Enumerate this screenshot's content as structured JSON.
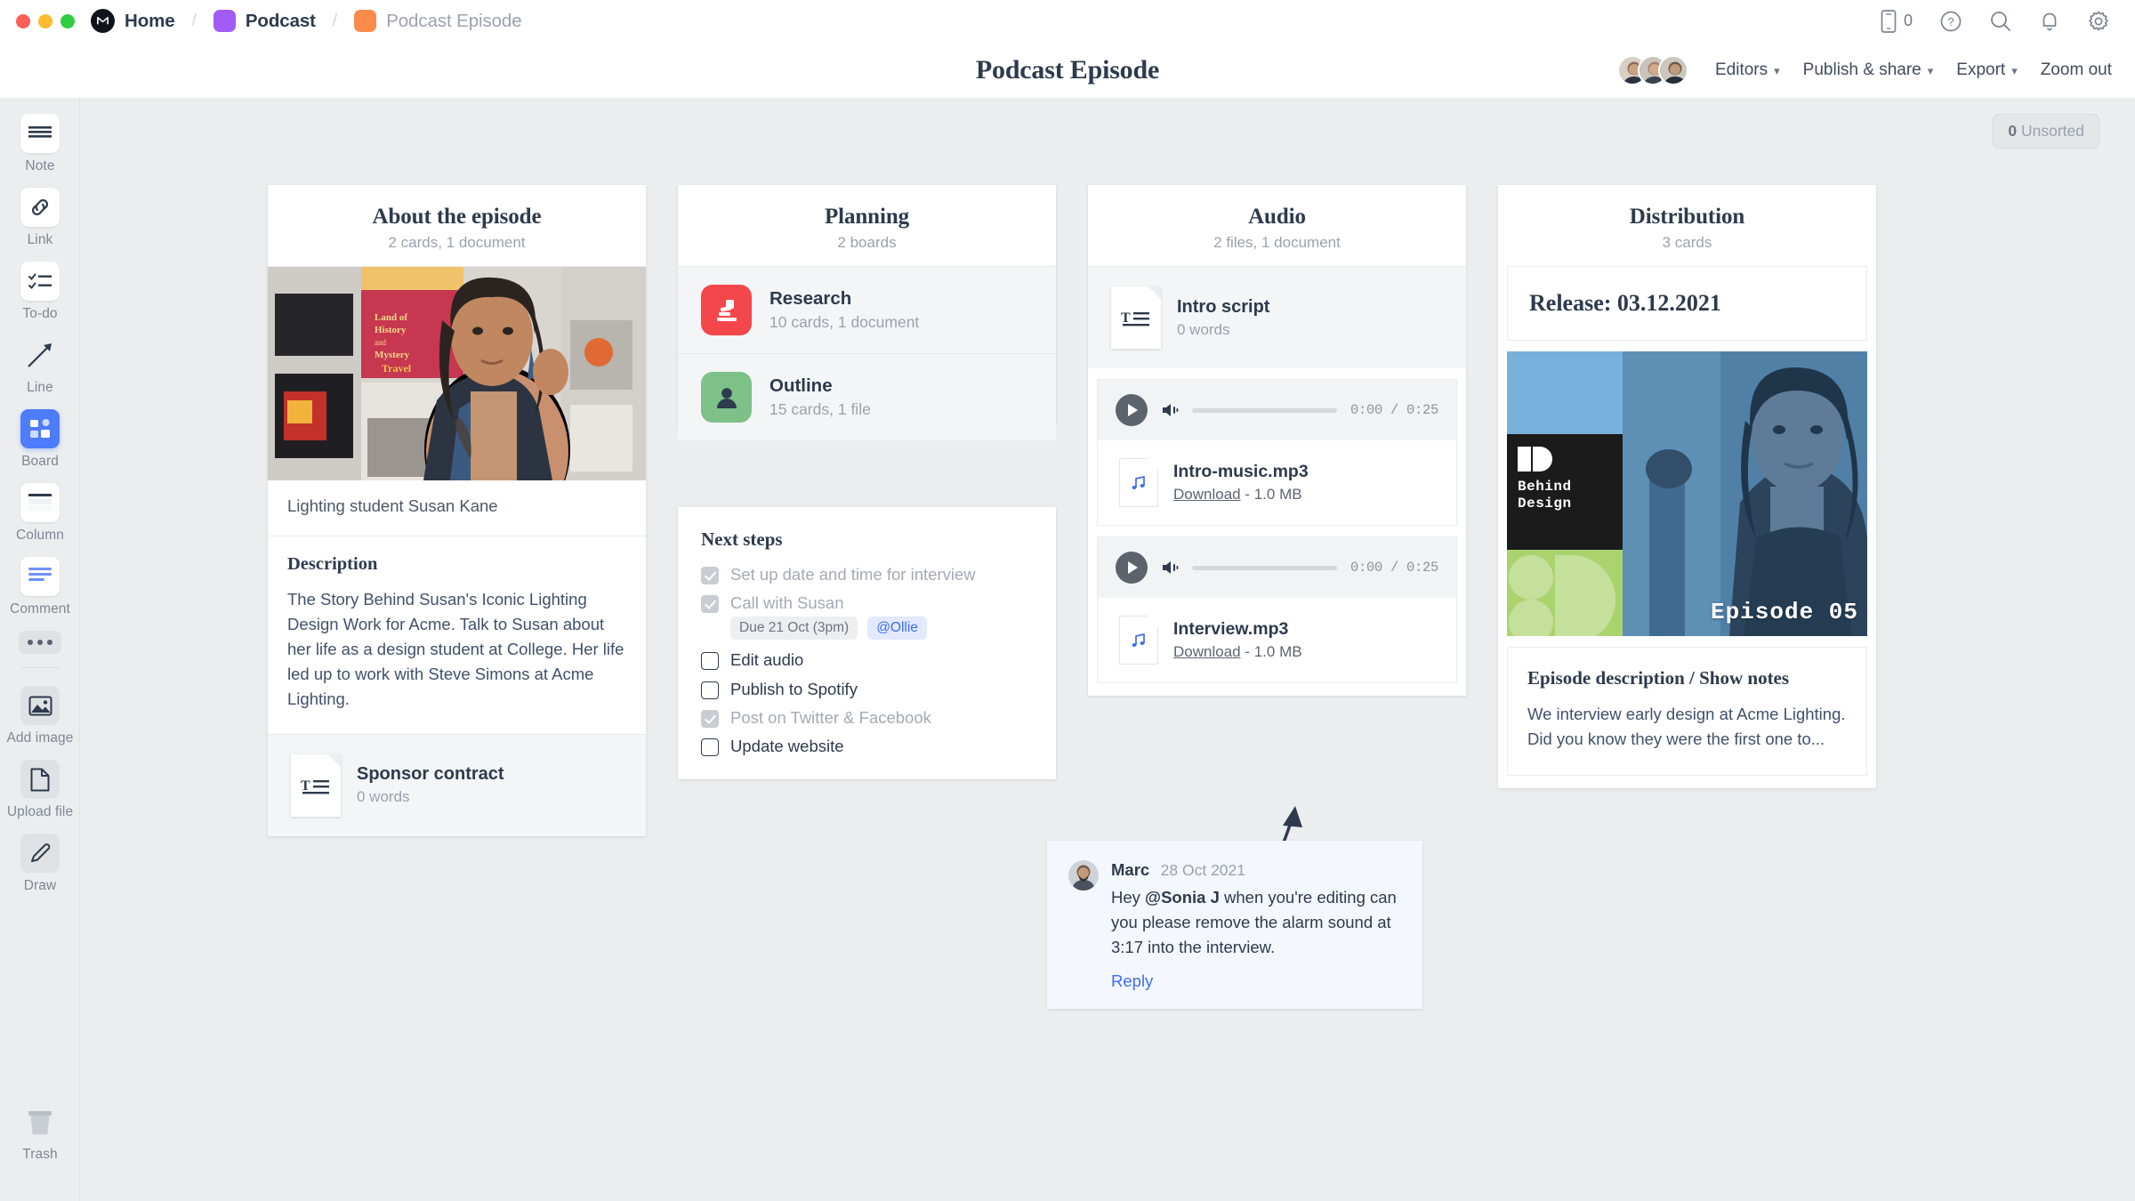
{
  "window": {
    "traffic_lights": [
      "close",
      "minimize",
      "maximize"
    ]
  },
  "breadcrumb": {
    "home": "Home",
    "project": "Podcast",
    "current": "Podcast Episode",
    "separator": "/",
    "project_color": "#a15cf5",
    "current_color": "#fb8b4b"
  },
  "top_right": {
    "device_count": "0",
    "icons": [
      "mobile-icon",
      "help-icon",
      "search-icon",
      "notifications-icon",
      "settings-icon"
    ]
  },
  "header": {
    "title": "Podcast Episode",
    "editors_label": "Editors",
    "publish_label": "Publish & share",
    "export_label": "Export",
    "zoom_label": "Zoom out",
    "avatar_count": 3
  },
  "sidebar": {
    "items": [
      {
        "label": "Note",
        "icon": "note-icon"
      },
      {
        "label": "Link",
        "icon": "link-icon"
      },
      {
        "label": "To-do",
        "icon": "todo-icon"
      },
      {
        "label": "Line",
        "icon": "line-icon"
      },
      {
        "label": "Board",
        "icon": "board-icon",
        "active": true
      },
      {
        "label": "Column",
        "icon": "column-icon"
      },
      {
        "label": "Comment",
        "icon": "comment-icon"
      },
      {
        "label": "Add image",
        "icon": "image-icon"
      },
      {
        "label": "Upload file",
        "icon": "file-icon"
      },
      {
        "label": "Draw",
        "icon": "pencil-icon"
      }
    ],
    "more_label": "more-options",
    "trash_label": "Trash"
  },
  "canvas": {
    "unsorted_count": "0",
    "unsorted_label": "Unsorted"
  },
  "columns": [
    {
      "id": "about",
      "title": "About the episode",
      "subtitle": "2 cards, 1 document",
      "photo_caption": "Lighting student Susan Kane",
      "description_heading": "Description",
      "description_body": "The Story Behind Susan's Iconic Lighting Design Work for Acme. Talk to Susan about her life as a design student at College. Her life led up to work with Steve Simons at Acme Lighting.",
      "document": {
        "name": "Sponsor contract",
        "meta": "0 words",
        "icon": "text-document-icon"
      }
    },
    {
      "id": "planning",
      "title": "Planning",
      "subtitle": "2 boards",
      "boards": [
        {
          "name": "Research",
          "meta": "10 cards, 1 document",
          "color": "#f4474b",
          "icon": "microscope-icon"
        },
        {
          "name": "Outline",
          "meta": "15 cards, 1 file",
          "color": "#7dc088",
          "icon": "person-icon"
        }
      ],
      "next_steps": {
        "heading": "Next steps",
        "items": [
          {
            "label": "Set up date and time for interview",
            "done": true
          },
          {
            "label": "Call with Susan",
            "done": true,
            "due": "Due 21 Oct (3pm)",
            "assignee": "@Ollie"
          },
          {
            "label": "Edit audio",
            "done": false
          },
          {
            "label": "Publish to Spotify",
            "done": false
          },
          {
            "label": "Post on Twitter & Facebook",
            "done": true
          },
          {
            "label": "Update website",
            "done": false
          }
        ]
      }
    },
    {
      "id": "audio",
      "title": "Audio",
      "subtitle": "2 files, 1 document",
      "document": {
        "name": "Intro script",
        "meta": "0 words",
        "icon": "text-document-icon"
      },
      "tracks": [
        {
          "name": "Intro-music.mp3",
          "download_label": "Download",
          "size": "- 1.0 MB",
          "time": "0:00 / 0:25",
          "icon": "music-note-icon"
        },
        {
          "name": "Interview.mp3",
          "download_label": "Download",
          "size": "- 1.0 MB",
          "time": "0:00 / 0:25",
          "icon": "music-note-icon"
        }
      ]
    },
    {
      "id": "distribution",
      "title": "Distribution",
      "subtitle": "3 cards",
      "release": "Release: 03.12.2021",
      "cover": {
        "brand_line1": "Behind",
        "brand_line2": "Design",
        "episode_label": "Episode 05"
      },
      "notes_heading": "Episode description / Show notes",
      "notes_body": "We interview early design at Acme Lighting. Did you know they were the first one to..."
    }
  ],
  "comment": {
    "author": "Marc",
    "date": "28 Oct 2021",
    "text_before": "Hey ",
    "mention": "@Sonia J",
    "text_after": " when you're editing can you please remove the alarm sound at 3:17 into the interview.",
    "reply_label": "Reply"
  }
}
